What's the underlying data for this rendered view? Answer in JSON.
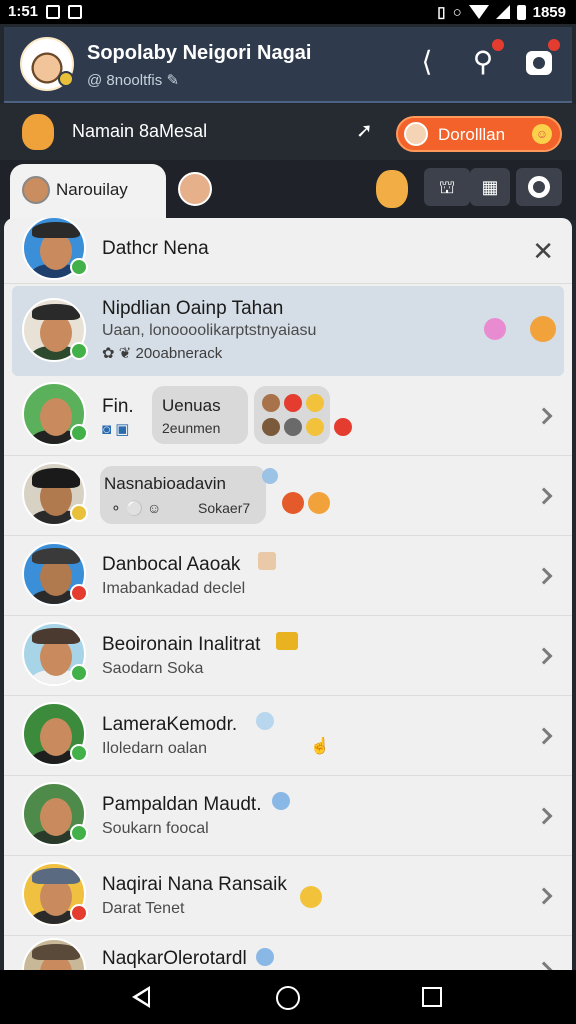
{
  "status_bar": {
    "time": "1:51",
    "battery": "1859"
  },
  "header": {
    "title": "Sopolaby Neigori Nagai",
    "subtitle": "@ 8nooltfis",
    "subtitle_icon": "pencil-icon"
  },
  "account": {
    "name": "Namain 8aMesal",
    "button_label": "Dorolllan"
  },
  "tabs": {
    "active_label": "Narouilay"
  },
  "list": {
    "header_name": "Dathcr Nena",
    "rows": [
      {
        "name": "Nipdlian Oainp Tahan",
        "sub": "Uaan, lonoooolikarptstnyaiasu",
        "meta": "20oabnerack",
        "status_color": "#43b14a",
        "selected": true
      },
      {
        "name": "Fin.",
        "bubble_title": "Uenuas",
        "bubble_sub": "2eunmen",
        "status_color": "#43b14a"
      },
      {
        "name": "Nasnabioadavin",
        "bubble_sub": "Sokaer7",
        "status_color": "#e8c03a"
      },
      {
        "name": "Danbocal Aaoak",
        "sub": "Imabankadad declel",
        "status_color": "#e43d30"
      },
      {
        "name": "Beoironain Inalitrat",
        "sub": "Saodarn Soka",
        "status_color": "#43b14a"
      },
      {
        "name": "LameraKemodr.",
        "sub": "Iloledarn oalan",
        "status_color": "#43b14a"
      },
      {
        "name": "Pampaldan Maudt.",
        "sub": "Soukarn foocal",
        "status_color": "#43b14a"
      },
      {
        "name": "Naqirai Nana Ransaik",
        "sub": "Darat Tenet",
        "status_color": "#e43d30"
      },
      {
        "name": "NaqkarOlerotardl",
        "sub": "",
        "status_color": "#43b14a"
      }
    ]
  },
  "colors": {
    "accent": "#f2622a",
    "header_bg": "#2f3b4c",
    "online": "#43b14a",
    "busy": "#e43d30",
    "away": "#e8c03a"
  }
}
